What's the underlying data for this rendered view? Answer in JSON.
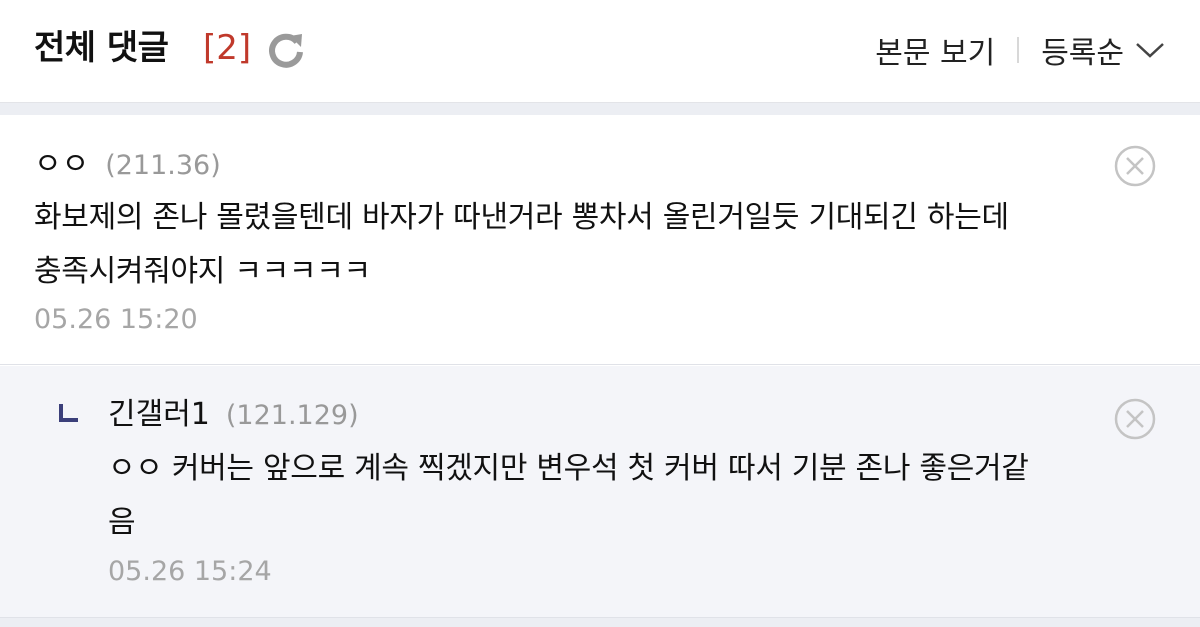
{
  "header": {
    "title": "전체 댓글",
    "count": "[2]",
    "view_body_label": "본문 보기",
    "sort_label": "등록순"
  },
  "comments": [
    {
      "author": "ㅇㅇ",
      "ip": "(211.36)",
      "text_line1": "화보제의 존나 몰렸을텐데 바자가 따낸거라 뽕차서 올린거일듯 기대되긴 하는데",
      "text_line2": "충족시켜줘야지 ㅋㅋㅋㅋㅋ",
      "timestamp": "05.26 15:20"
    },
    {
      "author": "긴갤러1",
      "ip": "(121.129)",
      "text_line1": "ㅇㅇ 커버는 앞으로 계속 찍겠지만 변우석 첫 커버 따서 기분 존나 좋은거같",
      "text_line2": "음",
      "timestamp": "05.26 15:24"
    }
  ],
  "colors": {
    "count_red": "#c0392b",
    "reply_marker": "#3b3f7a",
    "muted_text": "#999999",
    "reply_bg": "#f4f5f9"
  }
}
